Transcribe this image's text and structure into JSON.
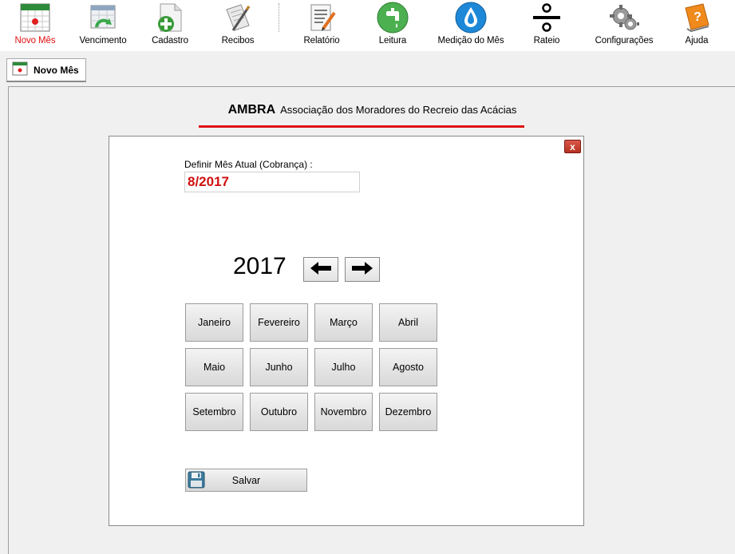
{
  "toolbar": {
    "items": [
      {
        "label": "Novo Mês",
        "icon": "calendar-icon",
        "active": true
      },
      {
        "label": "Vencimento",
        "icon": "calendar-refresh-icon"
      },
      {
        "label": "Cadastro",
        "icon": "document-add-icon"
      },
      {
        "label": "Recibos",
        "icon": "receipt-pen-icon"
      },
      {
        "label": "Relatório",
        "icon": "report-icon"
      },
      {
        "label": "Leitura",
        "icon": "faucet-icon"
      },
      {
        "label": "Medição do Mês",
        "icon": "water-drop-icon"
      },
      {
        "label": "Rateio",
        "icon": "divide-icon"
      },
      {
        "label": "Configurações",
        "icon": "gears-icon"
      },
      {
        "label": "Ajuda",
        "icon": "help-book-icon"
      }
    ]
  },
  "tab": {
    "label": "Novo Mês",
    "icon": "calendar-icon"
  },
  "header": {
    "brand": "AMBRA",
    "subtitle": "Associação dos Moradores do Recreio das Acácias"
  },
  "form": {
    "label": "Definir Mês Atual (Cobrança) :",
    "value": "8/2017",
    "year": "2017",
    "months": [
      "Janeiro",
      "Fevereiro",
      "Março",
      "Abril",
      "Maio",
      "Junho",
      "Julho",
      "Agosto",
      "Setembro",
      "Outubro",
      "Novembro",
      "Dezembro"
    ],
    "save_label": "Salvar",
    "close_label": "x"
  },
  "colors": {
    "accent": "#e01010",
    "value_text": "#d01010"
  }
}
